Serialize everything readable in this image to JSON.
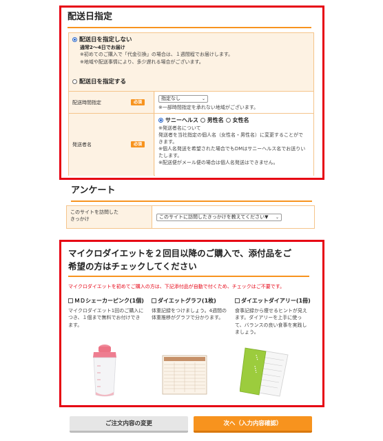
{
  "delivery": {
    "title": "配送日指定",
    "option_none": {
      "label": "配送日を指定しない",
      "sub": "通常2～4日でお届け",
      "note1": "※初めてのご購入で「代金引換」の場合は、１週間程でお届けします。",
      "note2": "※地域や配送事情により、多少遅れる場合がございます。"
    },
    "option_specify": {
      "label": "配送日を指定する"
    },
    "time_row": {
      "label": "配送時間指定",
      "badge": "必須",
      "select_value": "指定なし",
      "note": "※一部時間指定を承れない地域がございます。"
    },
    "sender_row": {
      "label": "発送者名",
      "badge": "必須",
      "options": [
        "サニーヘルス",
        "男性名",
        "女性名"
      ],
      "notes": [
        "※発送者名について",
        "発送者を当社指定の個人名（女性名・男性名）に変更することがで",
        "きます。",
        "※個人名発送を希望された場合でもDMはサニーヘルス名でお送りい",
        "たします。",
        "※配送便がメール便の場合は個人名発送はできません。"
      ]
    }
  },
  "survey": {
    "title": "アンケート",
    "question_line1": "このサイトを訪問した",
    "question_line2": "きっかけ",
    "select_value": "このサイトに訪問したきっかけを教えてください▼"
  },
  "gifts": {
    "title_line1": "マイクロダイエットを２回目以降のご購入で、添付品をご",
    "title_line2": "希望の方はチェックしてください",
    "warning": "マイクロダイエットを初めてご購入の方は、下記添付品が自動で付くため、チェックはご不要です。",
    "items": [
      {
        "name": "ＭＤシェーカーピンク(1個)",
        "desc": [
          "マイクロダイエット1回のご購入に",
          "つき、１個まで無料でお付けでき",
          "ます。"
        ]
      },
      {
        "name": "ダイエットグラフ(1枚)",
        "desc": [
          "体重記録をつけましょう。4週間の",
          "体重推移がグラフで分かります。"
        ]
      },
      {
        "name": "ダイエットダイアリー(1冊)",
        "desc": [
          "食事記録から痩せるヒントが見え",
          "ます。ダイアリーを上手に使っ",
          "て、バランスの良い食事を実践し",
          "ましょう。"
        ]
      }
    ]
  },
  "buttons": {
    "back": "ご注文内容の変更",
    "next": "次へ（入力内容確認）"
  },
  "colors": {
    "accent": "#f7931e",
    "highlight": "#e60012",
    "radio": "#2563c9"
  }
}
